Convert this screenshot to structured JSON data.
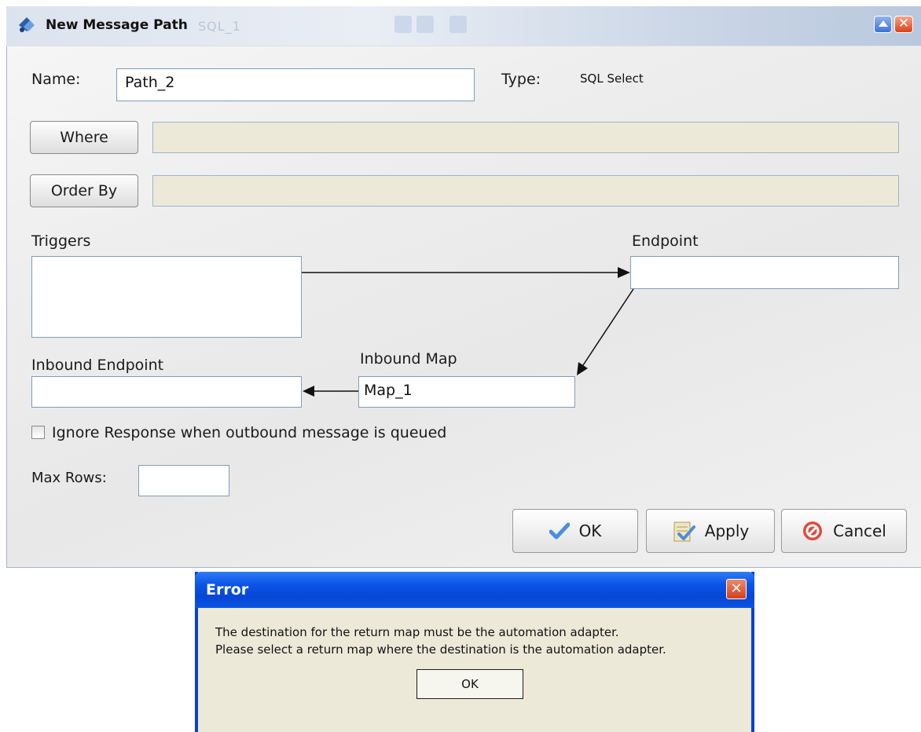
{
  "window": {
    "title": "New Message Path",
    "ghost_title": "SQL_1",
    "icons": {
      "app": "app-icon",
      "maximize": "maximize-icon",
      "close": "close-icon"
    }
  },
  "form": {
    "name_label": "Name:",
    "name_value": "Path_2",
    "type_label": "Type:",
    "type_value": "SQL Select",
    "where_button": "Where",
    "order_by_button": "Order By",
    "triggers_label": "Triggers",
    "endpoint_label": "Endpoint",
    "inbound_endpoint_label": "Inbound Endpoint",
    "inbound_map_label": "Inbound Map",
    "inbound_map_value": "Map_1",
    "ignore_response_label": "Ignore Response when outbound message is queued",
    "ignore_response_checked": false,
    "max_rows_label": "Max Rows:",
    "max_rows_value": ""
  },
  "buttons": {
    "ok": "OK",
    "apply": "Apply",
    "cancel": "Cancel"
  },
  "error_dialog": {
    "title": "Error",
    "close": "✕",
    "line1": "The destination for the return map must be the automation adapter.",
    "line2": "Please select a return map where the destination is the automation adapter.",
    "ok": "OK"
  }
}
